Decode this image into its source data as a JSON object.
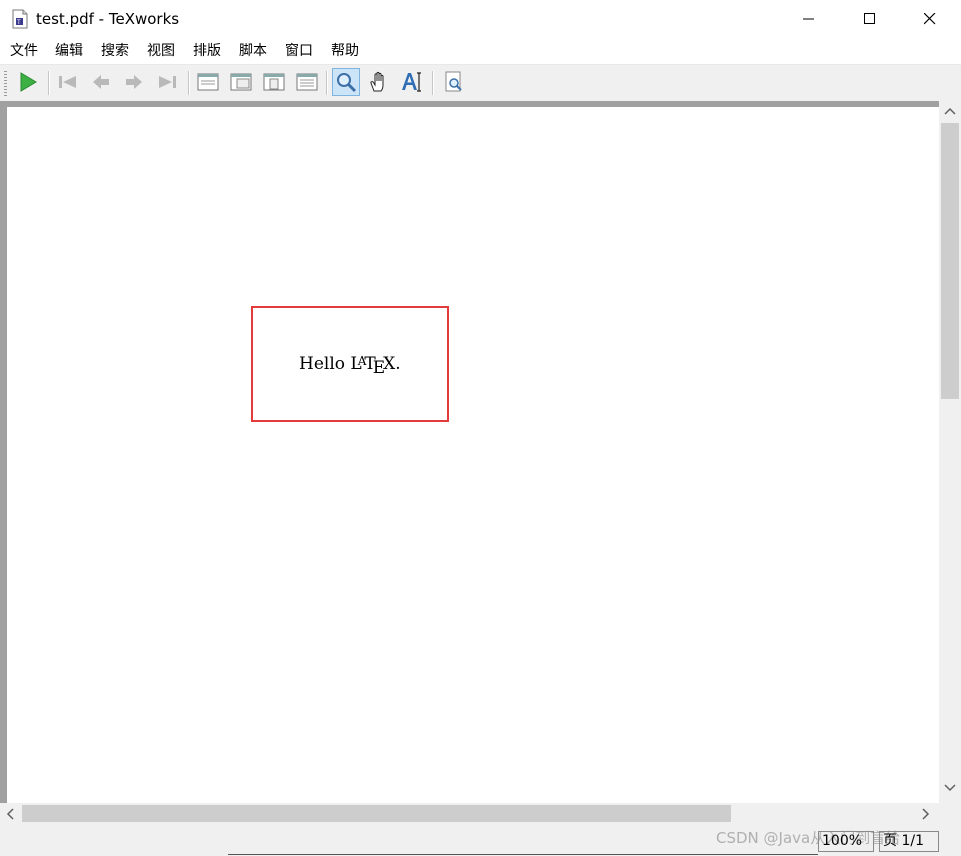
{
  "window": {
    "title": "test.pdf - TeXworks",
    "controls": [
      "minimize",
      "maximize",
      "close"
    ]
  },
  "menu": [
    "文件",
    "编辑",
    "搜索",
    "视图",
    "排版",
    "脚本",
    "窗口",
    "帮助"
  ],
  "toolbar": {
    "icons": [
      "typeset-play-icon",
      "first-page-icon",
      "previous-page-icon",
      "next-page-icon",
      "last-page-icon",
      "actual-size-icon",
      "fit-width-icon",
      "fit-page-icon",
      "fit-content-icon",
      "magnifier-tool-icon",
      "hand-scroll-tool-icon",
      "text-select-tool-icon",
      "goto-source-icon"
    ],
    "active_tool": "magnifier-tool-icon"
  },
  "document": {
    "text_prefix": "Hello ",
    "logo": {
      "l": "L",
      "a": "A",
      "t": "T",
      "e": "E",
      "x": "X"
    },
    "text_suffix": "."
  },
  "status": {
    "watermark": "CSDN @Java从入门到盲给",
    "zoom": "100%",
    "page": "页 1/1"
  },
  "colors": {
    "highlight_border": "#e33b3b",
    "play_icon": "#3cb043",
    "active_tool_bg": "#cce4f7"
  }
}
